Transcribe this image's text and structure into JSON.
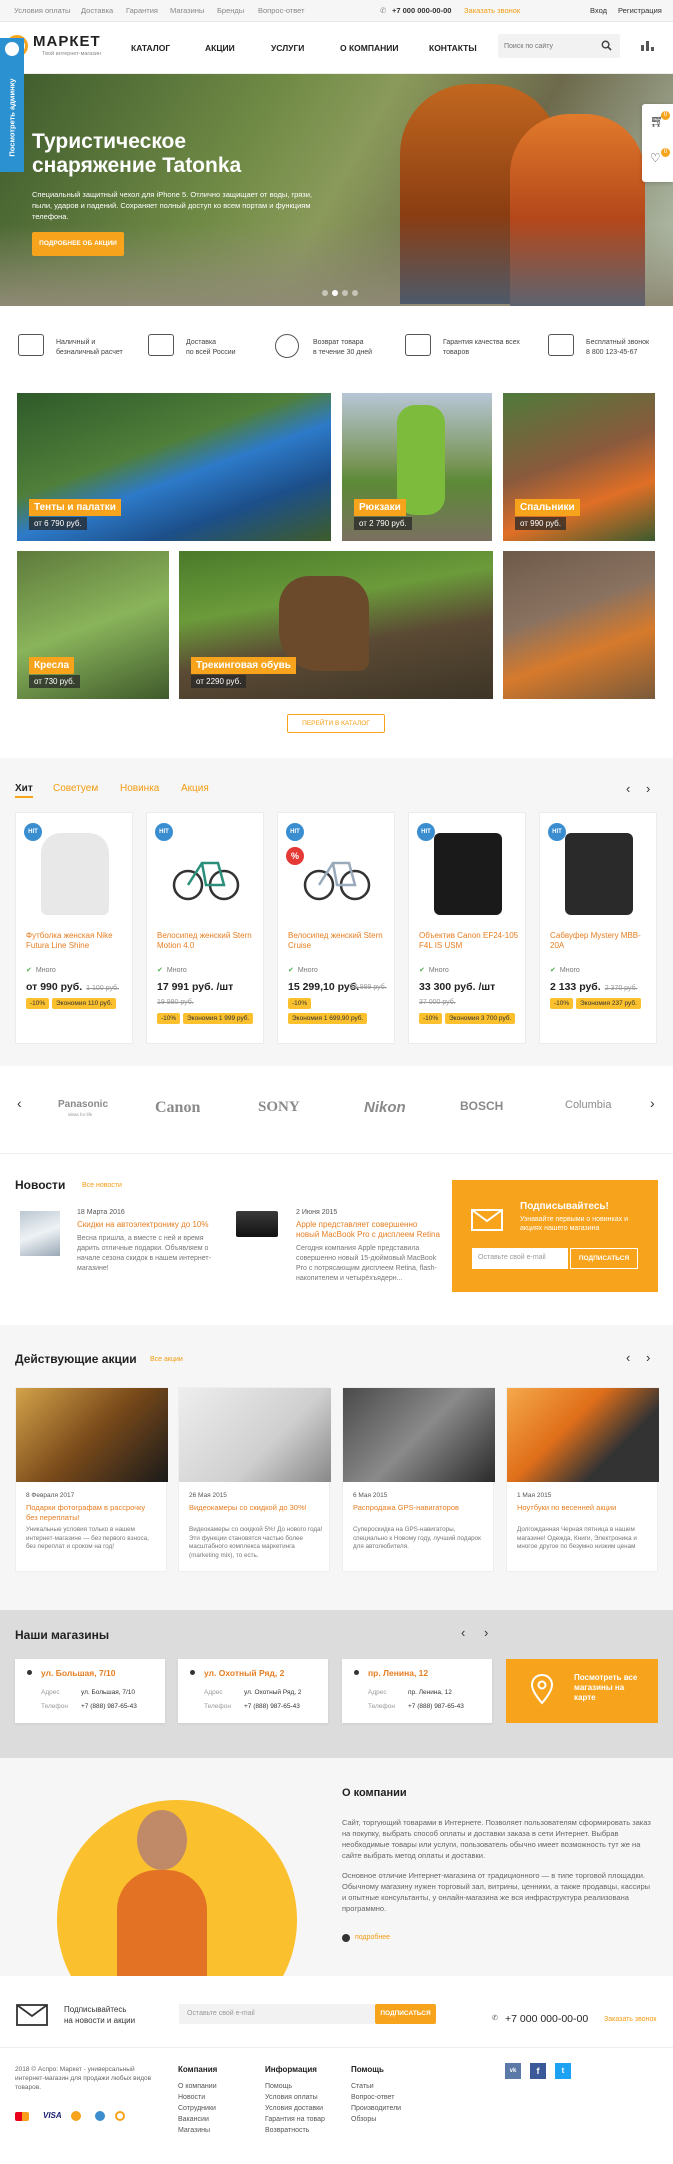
{
  "topbar": {
    "links": [
      "Условия оплаты",
      "Доставка",
      "Гарантия",
      "Магазины",
      "Бренды",
      "Вопрос-ответ"
    ],
    "phone": "+7 000 000-00-00",
    "callback": "Заказать звонок",
    "login": "Вход",
    "register": "Регистрация"
  },
  "header": {
    "logo": "МАРКЕТ",
    "tagline": "Твой интернет-магазин",
    "nav": [
      "КАТАЛОГ",
      "АКЦИИ",
      "УСЛУГИ",
      "О КОМПАНИИ",
      "КОНТАКТЫ"
    ],
    "search_placeholder": "Поиск по сайту",
    "admin_tab": "Посмотреть админку",
    "cart_count": "0",
    "compare_count": "0"
  },
  "hero": {
    "title_1": "Туристическое",
    "title_2": "снаряжение Tatonka",
    "text": "Специальный защитный чехол для iPhone 5. Отлично защищает от воды, грязи, пыли, ударов и падений. Сохраняет полный доступ ко всем портам и функциям телефона.",
    "button": "ПОДРОБНЕЕ ОБ АКЦИИ",
    "slides": 4,
    "active_slide": 1
  },
  "features": [
    {
      "icon": "wallet-icon",
      "line1": "Наличный и",
      "line2": "безналичный расчет"
    },
    {
      "icon": "truck-icon",
      "line1": "Доставка",
      "line2": "по всей России"
    },
    {
      "icon": "return-30-icon",
      "line1": "Возврат товара",
      "line2": "в течение 30 дней"
    },
    {
      "icon": "quality-star-icon",
      "line1": "Гарантия качества всех",
      "line2": "товаров"
    },
    {
      "icon": "phone-icon",
      "line1": "Бесплатный звонок",
      "line2": "8 800 123-45-67"
    }
  ],
  "categories": [
    {
      "title": "Тенты и палатки",
      "price": "от 6 790 руб."
    },
    {
      "title": "Рюкзаки",
      "price": "от 2 790 руб."
    },
    {
      "title": "Спальники",
      "price": "от 990 руб."
    },
    {
      "title": "Кресла",
      "price": "от 730 руб."
    },
    {
      "title": "Трекинговая обувь",
      "price": "от 2290 руб."
    }
  ],
  "catalog_button": "ПЕРЕЙТИ В КАТАЛОГ",
  "product_tabs": [
    "Хит",
    "Советуем",
    "Новинка",
    "Акция"
  ],
  "products": [
    {
      "badge": "HIT",
      "name": "Футболка женская Nike Futura Line Shine",
      "stock": "Много",
      "price": "от 990 руб.",
      "old": "1 100 руб.",
      "discount": "-10%",
      "save": "Экономия 110 руб."
    },
    {
      "badge": "HIT",
      "name": "Велосипед женский Stern Motion 4.0",
      "stock": "Много",
      "price": "17 991 руб. /шт",
      "old": "19 990 руб.",
      "discount": "-10%",
      "save": "Экономия 1 999 руб."
    },
    {
      "badge": "HIT",
      "badge2": "%",
      "name": "Велосипед женский Stern Cruise",
      "stock": "Много",
      "price": "15 299,10 руб.",
      "old": "16 999 руб.",
      "discount": "-10%",
      "save": "Экономия 1 699,90 руб."
    },
    {
      "badge": "HIT",
      "name": "Объектив Canon EF24-105 F4L IS USM",
      "stock": "Много",
      "price": "33 300 руб. /шт",
      "old": "37 000 руб.",
      "discount": "-10%",
      "save": "Экономия 3 700 руб."
    },
    {
      "badge": "HIT",
      "name": "Сабвуфер Mystery MBB-20A",
      "stock": "Много",
      "price": "2 133 руб.",
      "old": "2 370 руб.",
      "discount": "-10%",
      "save": "Экономия 237 руб."
    }
  ],
  "brands": [
    "Panasonic",
    "Canon",
    "SONY",
    "Nikon",
    "BOSCH",
    "Columbia"
  ],
  "brand_taglines": {
    "panasonic": "ideas for life"
  },
  "news": {
    "title": "Новости",
    "all": "Все новости",
    "items": [
      {
        "date": "18 Марта 2016",
        "title": "Скидки на автоэлектронику до 10%",
        "text": "Весна пришла, а вместе с ней и время дарить отличные подарки. Объявляем о начале сезона скидок в нашем интернет-магазине!"
      },
      {
        "date": "2 Июня 2015",
        "title": "Apple представляет совершенно новый MacBook Pro с дисплеем Retina",
        "text": "Сегодня компания Apple представила совершенно новый 15-дюймовый MacBook Pro с потрясающим дисплеем Retina, flash-накопителем и четырёхъядерн..."
      }
    ]
  },
  "subscribe": {
    "title": "Подписывайтесь!",
    "text": "Узнавайте первыми о новинках и акциях нашего магазина",
    "placeholder": "Оставьте свой e-mail",
    "button": "ПОДПИСАТЬСЯ"
  },
  "promos": {
    "title": "Действующие акции",
    "all": "Все акции",
    "items": [
      {
        "date": "8 Февраля 2017",
        "title": "Подарки фотографам в рассрочку без переплаты!",
        "text": "Уникальные условия только в нашем интернет-магазине — без первого взноса, без переплат и сроком на год!"
      },
      {
        "date": "26 Мая 2015",
        "title": "Видеокамеры со скидкой до 30%!",
        "text": "Видеокамеры со скидкой 5%! До нового года! Эти функции становятся частью более масштабного комплекса маркетинга (marketing mix), то есть."
      },
      {
        "date": "6 Мая 2015",
        "title": "Распродажа GPS-навигаторов",
        "text": "Супероскидка на GPS-навигаторы, специально к Новому году, лучший подарок для автолюбителя."
      },
      {
        "date": "1 Мая 2015",
        "title": "Ноутбуки по весенней акции",
        "text": "Долгожданная Черная пятница в нашем магазине! Одежда, Книги, Электроника и многое другое по безумно низким ценам"
      }
    ]
  },
  "stores": {
    "title": "Наши магазины",
    "items": [
      {
        "name": "ул. Большая, 7/10",
        "address_label": "Адрес",
        "address": "ул. Большая, 7/10",
        "phone_label": "Телефон",
        "phone": "+7 (888) 987-65-43"
      },
      {
        "name": "ул. Охотный Ряд, 2",
        "address_label": "Адрес",
        "address": "ул. Охотный Ряд, 2",
        "phone_label": "Телефон",
        "phone": "+7 (888) 987-65-43"
      },
      {
        "name": "пр. Ленина, 12",
        "address_label": "Адрес",
        "address": "пр. Ленина, 12",
        "phone_label": "Телефон",
        "phone": "+7 (888) 987-65-43"
      }
    ],
    "map_cta": "Посмотреть все магазины на карте"
  },
  "about": {
    "title": "О компании",
    "p1": "Сайт, торгующий товарами в Интернете. Позволяет пользователям сформировать заказ на покупку, выбрать способ оплаты и доставки заказа в сети Интернет. Выбрав необходимые товары или услуги, пользователь обычно имеет возможность тут же на сайте выбрать метод оплаты и доставки.",
    "p2": "Основное отличие Интернет-магазина от традиционного — в типе торговой площадки. Обычному магазину нужен торговый зал, витрины, ценники, а также продавцы, кассиры и опытные консультанты, у онлайн-магазина же вся инфраструктура реализована программно.",
    "more": "подробнее"
  },
  "footer": {
    "sub_text_1": "Подписывайтесь",
    "sub_text_2": "на новости и акции",
    "placeholder": "Оставьте свой e-mail",
    "button": "ПОДПИСАТЬСЯ",
    "phone": "+7 000 000-00-00",
    "callback": "Заказать звонок",
    "copyright": "2018 © Аспро: Маркет - универсальный интернет-магазин для продажи любых видов товаров.",
    "cols": [
      {
        "h": "Компания",
        "links": [
          "О компании",
          "Новости",
          "Сотрудники",
          "Вакансии",
          "Магазины"
        ]
      },
      {
        "h": "Информация",
        "links": [
          "Помощь",
          "Условия оплаты",
          "Условия доставки",
          "Гарантия на товар",
          "Возвратность"
        ]
      },
      {
        "h": "Помощь",
        "links": [
          "Статьи",
          "Вопрос-ответ",
          "Производители",
          "Обзоры"
        ]
      }
    ],
    "social": [
      "vk",
      "fb",
      "tw"
    ]
  }
}
